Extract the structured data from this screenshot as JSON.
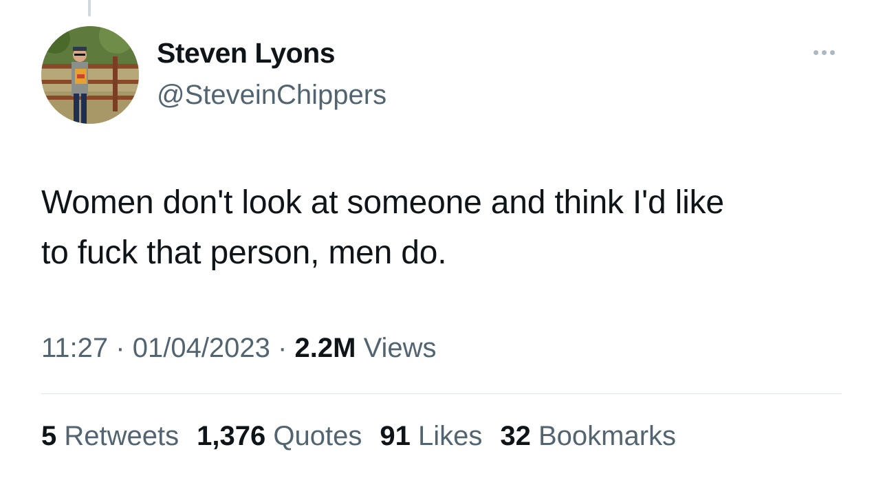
{
  "author": {
    "name": "Steven Lyons",
    "handle": "@SteveinChippers",
    "avatar_icon": "profile-photo-icon"
  },
  "more_icon": "more-horizontal-icon",
  "tweet": {
    "text": "Women don't look at someone and think I'd like\nto fuck that person, men do.",
    "time": "11:27",
    "date": "01/04/2023",
    "views_count": "2.2M",
    "views_label": "Views",
    "separator": "·"
  },
  "stats": {
    "retweets": {
      "count": "5",
      "label": "Retweets"
    },
    "quotes": {
      "count": "1,376",
      "label": "Quotes"
    },
    "likes": {
      "count": "91",
      "label": "Likes"
    },
    "bookmarks": {
      "count": "32",
      "label": "Bookmarks"
    }
  },
  "colors": {
    "text_primary": "#0f1419",
    "text_secondary": "#536471",
    "divider": "#dfe4e8"
  }
}
